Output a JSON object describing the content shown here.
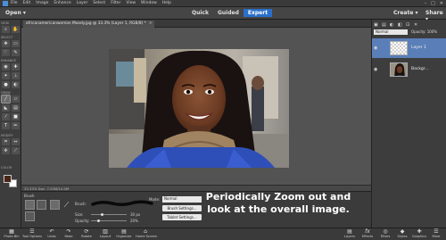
{
  "menubar": {
    "items": [
      "File",
      "Edit",
      "Image",
      "Enhance",
      "Layer",
      "Select",
      "Filter",
      "View",
      "Window",
      "Help"
    ],
    "window_controls": [
      "–",
      "□",
      "✕"
    ]
  },
  "modebar": {
    "open_label": "Open ▾",
    "modes": [
      "Quick",
      "Guided",
      "Expert"
    ],
    "active_mode": "Expert",
    "create_label": "Create ▾",
    "share_label": "Share ▾"
  },
  "toolbox": {
    "sections": [
      "VIEW",
      "SELECT",
      "ENHANCE",
      "DRAW",
      "MODIFY",
      "COLOR"
    ],
    "foreground_color": "#4a2416",
    "background_color": "#ffffff"
  },
  "document": {
    "tab_title": "africanamericanwoman Moody.jpg @ 33.3% (Layer 1, RGB/8) *",
    "status": "33.33%   Doc: 7.03M/14.0M"
  },
  "tool_options": {
    "section_label": "Brush",
    "brush_label": "Brush:",
    "size_label": "Size:",
    "size_value": "30 px",
    "size_fraction": 0.3,
    "opacity_label": "Opacity:",
    "opacity_value": "20%",
    "opacity_fraction": 0.2,
    "mode_label": "Mode:",
    "mode_value": "Normal",
    "brush_settings_label": "Brush Settings...",
    "tablet_settings_label": "Tablet Settings..."
  },
  "overlay": {
    "text": "Periodically Zoom out and look at the overall image."
  },
  "layers_panel": {
    "blend_mode": "Normal",
    "opacity_label": "Opacity:",
    "opacity_value": "100%",
    "layers": [
      {
        "name": "Layer 1",
        "selected": true
      },
      {
        "name": "Backgr...",
        "selected": false
      }
    ]
  },
  "bottombar": {
    "left_items": [
      "Photo Bin",
      "Tool Options",
      "Undo",
      "Redo",
      "Rotate",
      "Layout",
      "Organizer",
      "Home Screen"
    ],
    "right_items": [
      "Layers",
      "Effects",
      "Filters",
      "Styles",
      "Graphics",
      "More"
    ]
  }
}
